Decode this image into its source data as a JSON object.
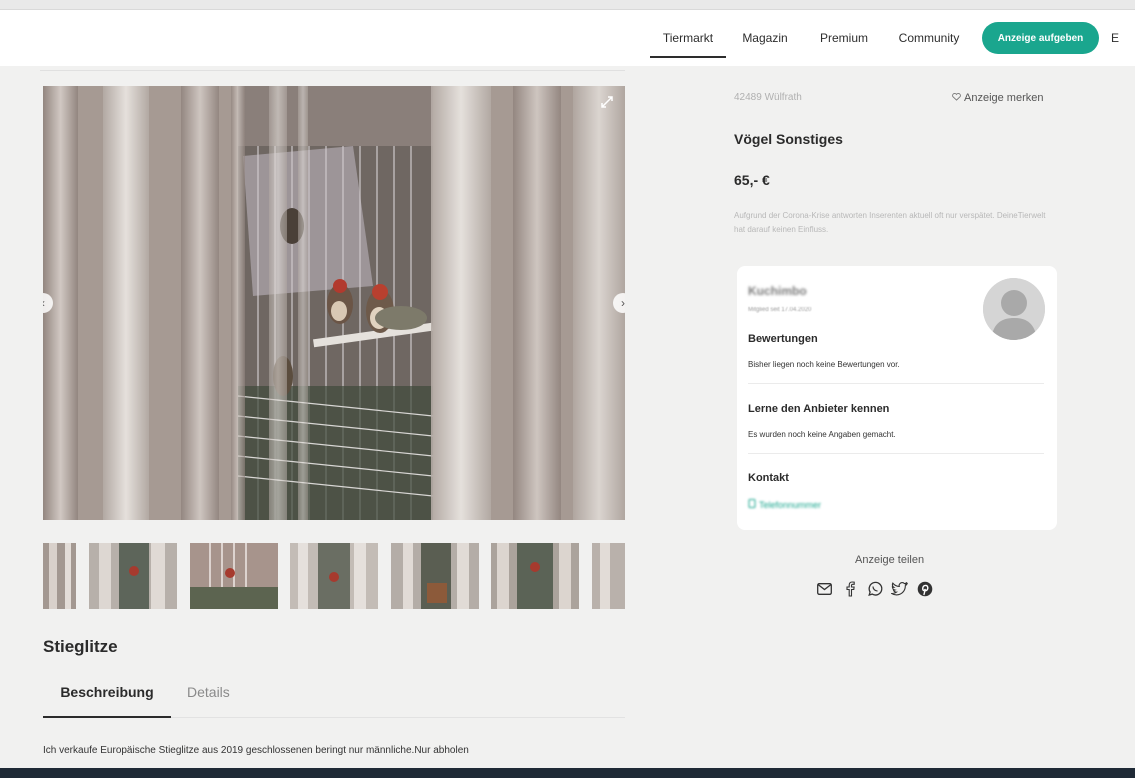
{
  "header": {
    "nav": [
      {
        "label": "Tiermarkt",
        "active": true
      },
      {
        "label": "Magazin",
        "active": false
      },
      {
        "label": "Premium",
        "active": false
      },
      {
        "label": "Community",
        "active": false
      }
    ],
    "cta_label": "Anzeige aufgeben",
    "cut_off_label": "E"
  },
  "listing": {
    "title": "Stieglitze",
    "tabs": [
      "Beschreibung",
      "Details"
    ],
    "description": "Ich verkaufe Europäische Stieglitze aus 2019 geschlossenen beringt nur männliche.Nur abholen"
  },
  "details": {
    "location": "42489 Wülfrath",
    "bookmark_label": "Anzeige merken",
    "category": "Vögel Sonstiges",
    "price": "65,- €",
    "notice": "Aufgrund der Corona-Krise antworten Inserenten aktuell oft nur verspätet. DeineTierwelt hat darauf keinen Einfluss."
  },
  "seller": {
    "name": "Kuchimbo",
    "member_since": "Mitglied seit 17.04.2020",
    "ratings_heading": "Bewertungen",
    "ratings_text": "Bisher liegen noch keine Bewertungen vor.",
    "about_heading": "Lerne den Anbieter kennen",
    "about_text": "Es wurden noch keine Angaben gemacht.",
    "contact_heading": "Kontakt",
    "contact_link": "Telefonnummer"
  },
  "share": {
    "label": "Anzeige teilen",
    "icons": [
      "mail-icon",
      "facebook-icon",
      "whatsapp-icon",
      "twitter-icon",
      "pinterest-icon"
    ]
  },
  "colors": {
    "accent": "#1aa68e",
    "background": "#f1f1f0",
    "card": "#ffffff"
  }
}
